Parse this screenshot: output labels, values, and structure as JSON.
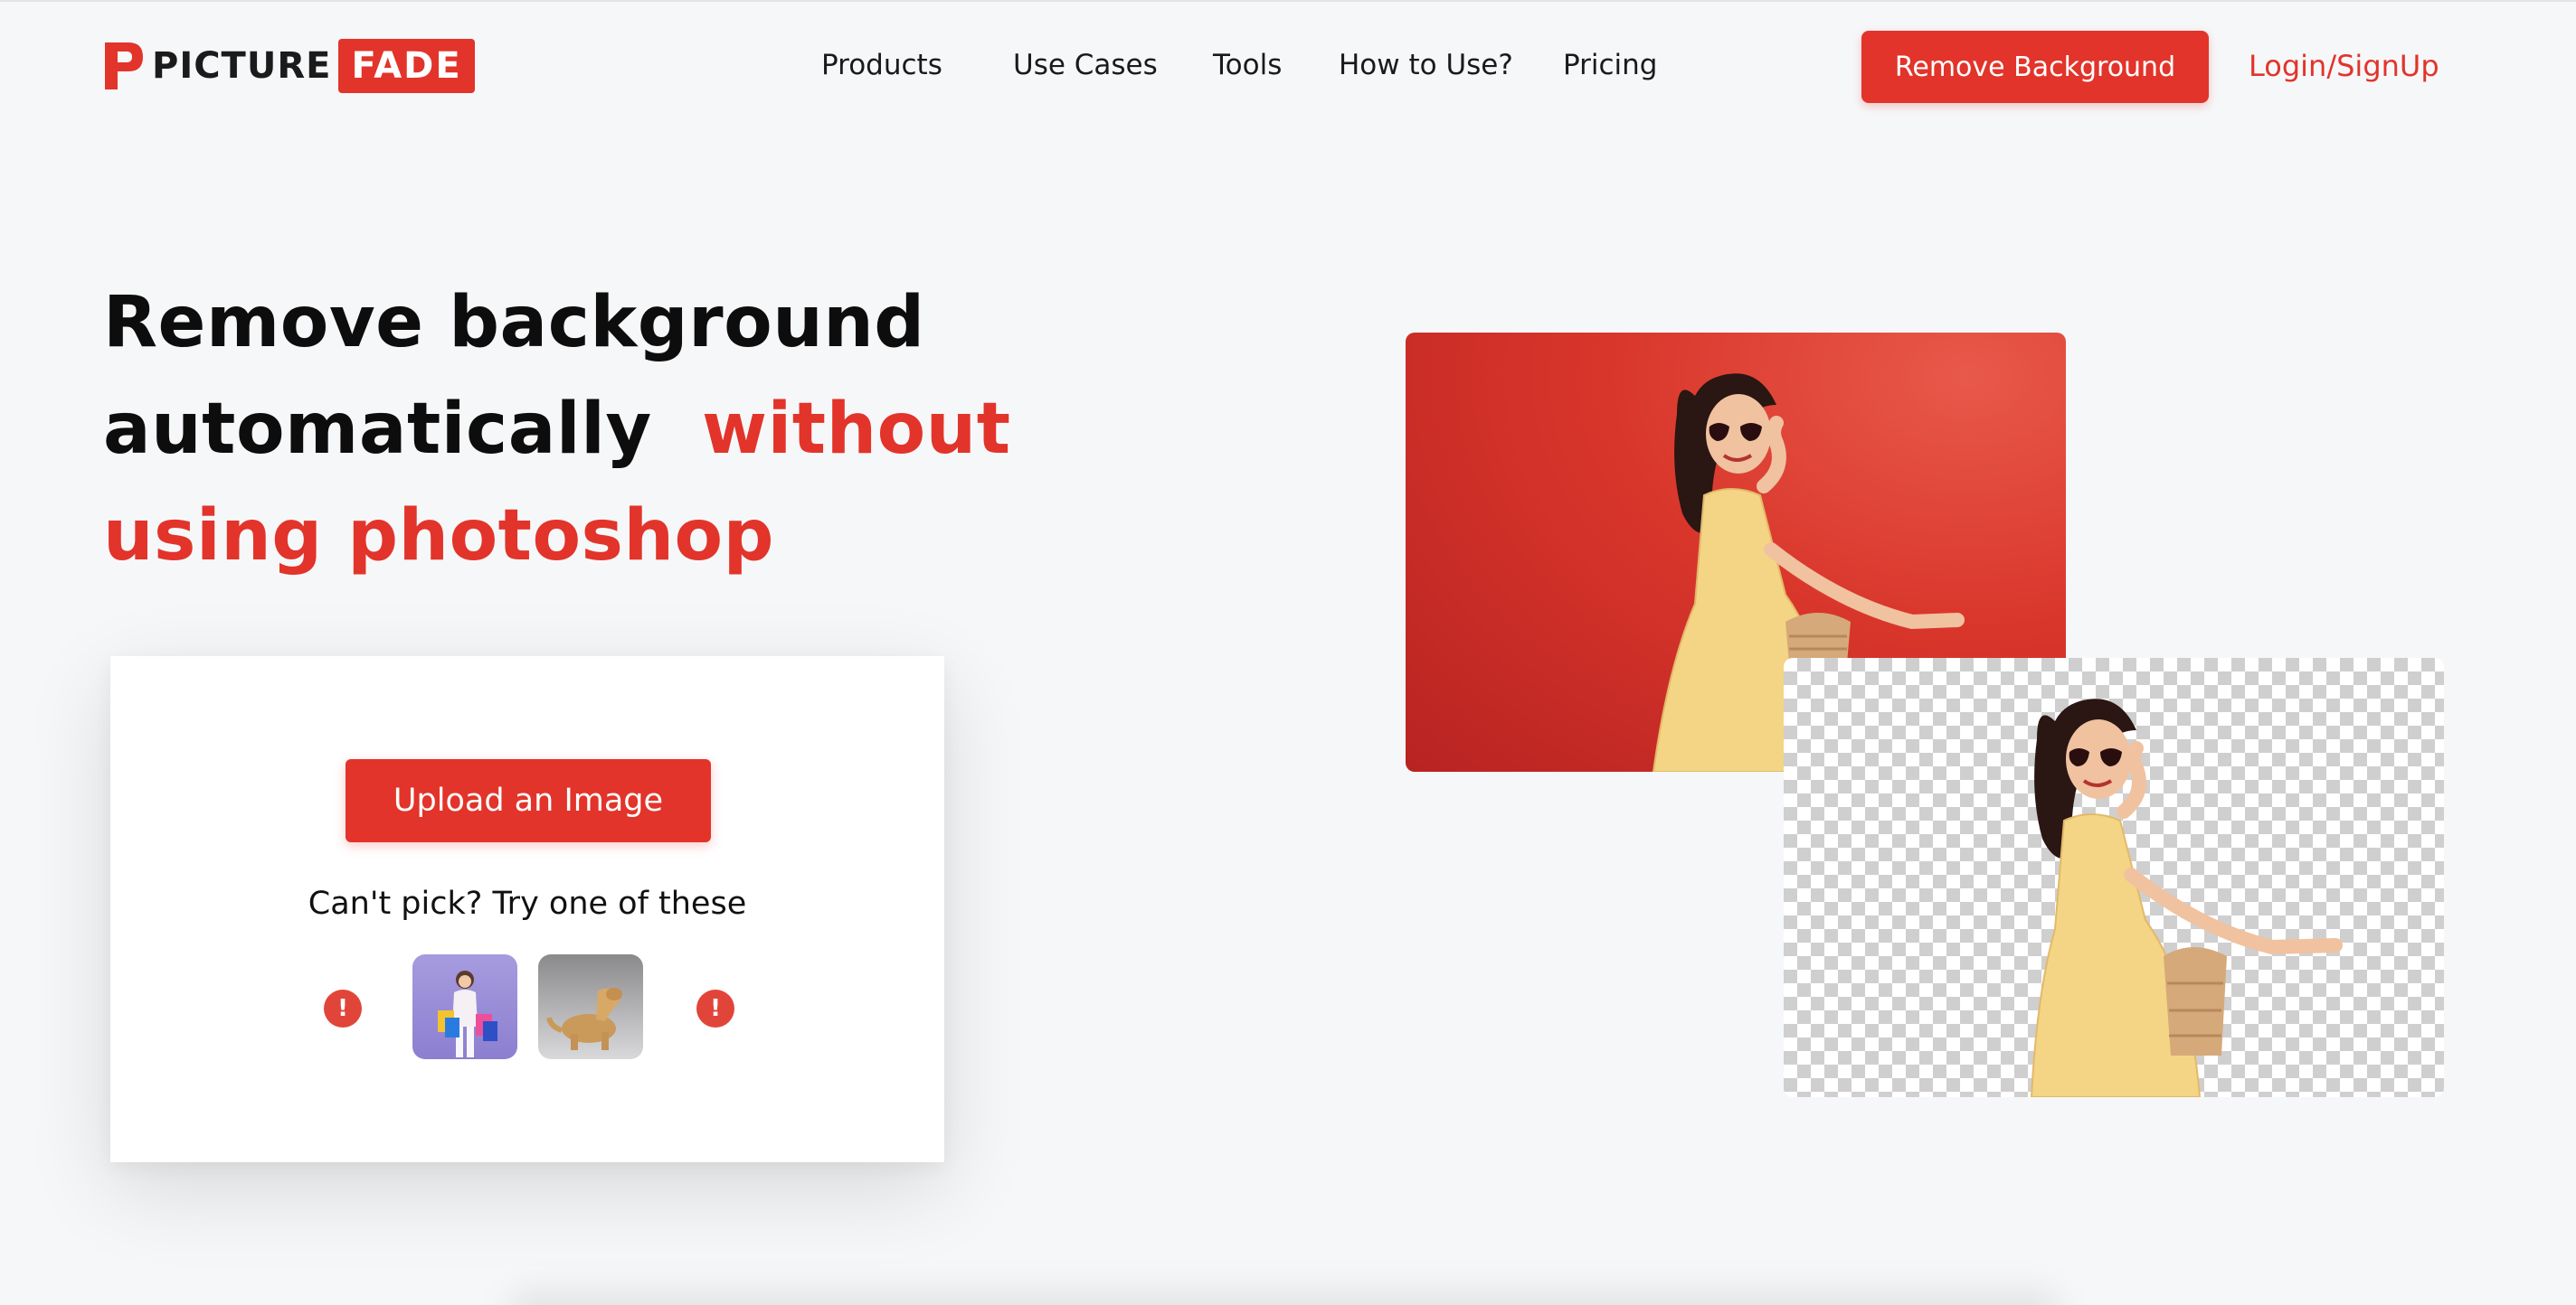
{
  "brand": {
    "name_part1": "PICTURE",
    "name_part2": "FADE",
    "accent_color": "#e2342a"
  },
  "nav": {
    "items": [
      {
        "label": "Products"
      },
      {
        "label": "Use Cases"
      },
      {
        "label": "Tools"
      },
      {
        "label": "How to Use?"
      },
      {
        "label": "Pricing"
      }
    ],
    "cta_label": "Remove Background",
    "login_label": "Login/SignUp"
  },
  "hero": {
    "title_line1": "Remove background",
    "title_line2_plain": "automatically",
    "title_line2_accent": "without",
    "title_line3_accent": "using photoshop"
  },
  "upload": {
    "button_label": "Upload an Image",
    "samples_prompt": "Can't pick? Try one of these",
    "alert_glyph": "!",
    "samples": [
      {
        "icon": "shopping-woman-thumbnail"
      },
      {
        "icon": "dog-thumbnail"
      }
    ]
  },
  "showcase": {
    "before_icon": "woman-red-background-photo",
    "after_icon": "woman-transparent-background-photo"
  }
}
